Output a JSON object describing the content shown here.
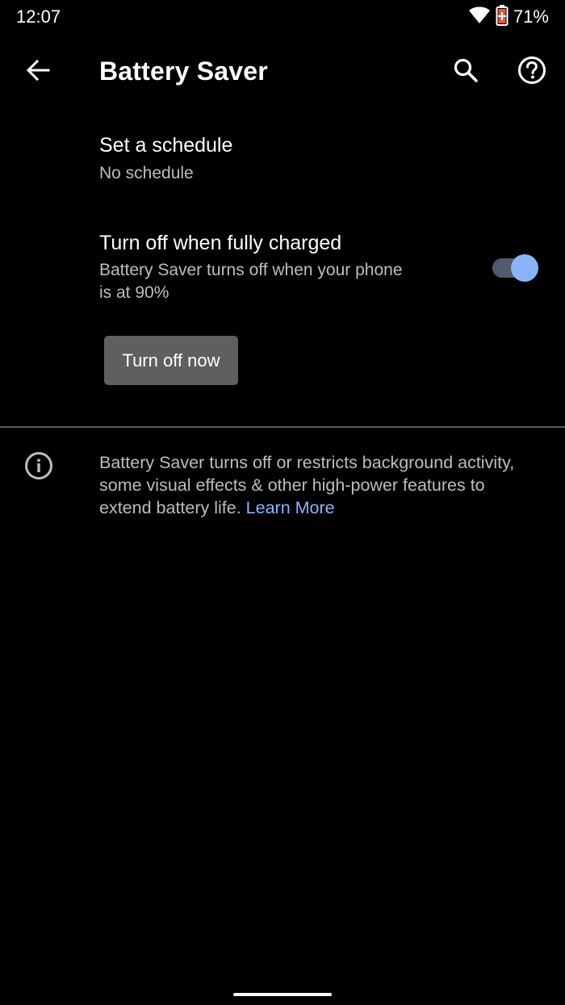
{
  "status_bar": {
    "time": "12:07",
    "battery_percent": "71%",
    "icons": [
      "wifi-icon",
      "battery-saver-icon"
    ]
  },
  "app_bar": {
    "title": "Battery Saver",
    "icons": [
      "back-arrow-icon",
      "search-icon",
      "help-icon"
    ]
  },
  "preferences": {
    "schedule": {
      "title": "Set a schedule",
      "summary": "No schedule"
    },
    "turn_off_charged": {
      "title": "Turn off when fully charged",
      "summary_line1": "Battery Saver turns off when your phone",
      "summary_line2": "is at 90%",
      "toggle_on": true
    },
    "turn_off_now_button": "Turn off now"
  },
  "footer": {
    "text": "Battery Saver turns off or restricts background activity, some visual effects & other high-power features to extend battery life. ",
    "learn_more": "Learn More"
  },
  "colors": {
    "background": "#000000",
    "accent": "#8ab4f8",
    "secondary_text": "#bdbdbd",
    "button_bg": "#5f5f5f"
  }
}
